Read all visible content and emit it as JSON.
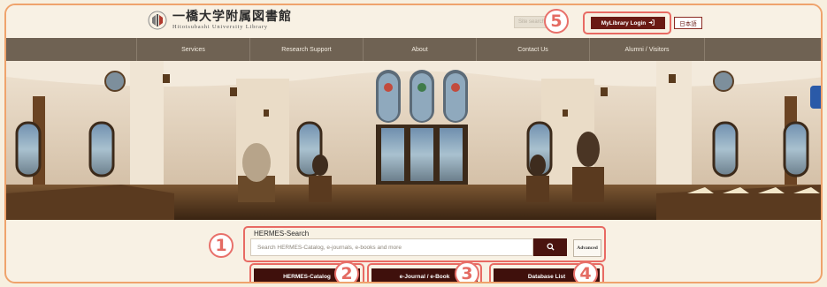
{
  "header": {
    "logo_jp": "一橋大学附属図書館",
    "logo_en": "Hitotsubashi University Library",
    "site_search_placeholder": "Site search",
    "mylibrary_label": "MyLibrary Login",
    "mylibrary_icon": "login-arrow-icon",
    "language_label": "日本語"
  },
  "nav": {
    "items": [
      {
        "label": "Services"
      },
      {
        "label": "Research Support"
      },
      {
        "label": "About"
      },
      {
        "label": "Contact Us"
      },
      {
        "label": "Alumni / Visitors"
      }
    ]
  },
  "search": {
    "title": "HERMES-Search",
    "placeholder": "Search HERMES-Catalog, e-journals, e-books and more",
    "search_icon": "search-icon",
    "advanced_label": "Advanced"
  },
  "quick_links": [
    {
      "label": "HERMES-Catalog"
    },
    {
      "label": "e-Journal / e-Book"
    },
    {
      "label": "Database List"
    }
  ],
  "callouts": {
    "n1": "1",
    "n2": "2",
    "n3": "3",
    "n4": "4",
    "n5": "5"
  },
  "colors": {
    "accent": "#6a1a14",
    "nav_bg": "#6f6253",
    "callout": "#e8706a",
    "page_bg": "#f8f1e4"
  }
}
